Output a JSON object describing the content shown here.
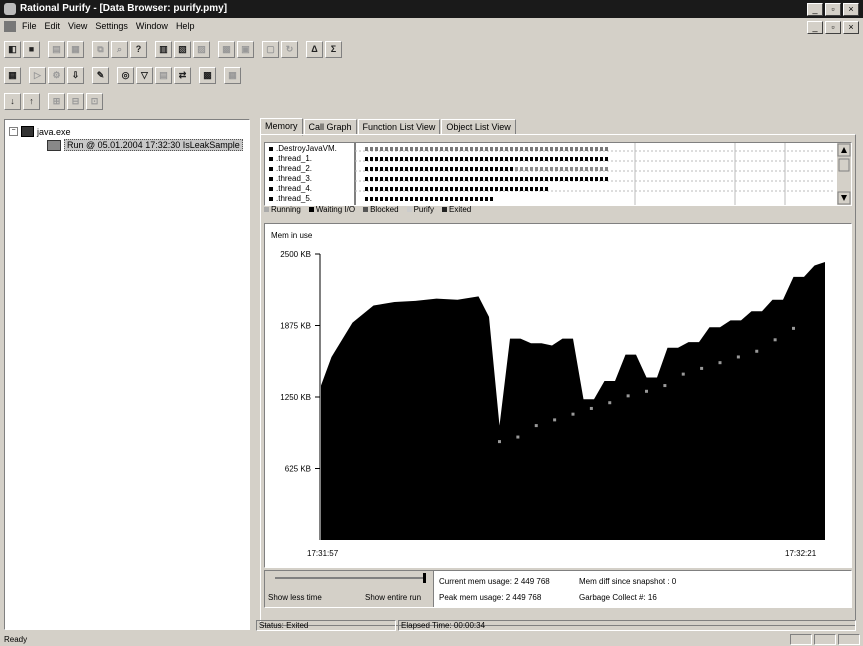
{
  "window": {
    "title": "Rational Purify - [Data Browser: purify.pmy]",
    "min": "_",
    "max": "▫",
    "close": "×"
  },
  "menu": [
    "File",
    "Edit",
    "View",
    "Settings",
    "Window",
    "Help"
  ],
  "tree": {
    "root": "java.exe",
    "child": "Run @ 05.01.2004 17:32:30 IsLeakSample"
  },
  "tabs": [
    "Memory",
    "Call Graph",
    "Function List View",
    "Object List View"
  ],
  "threads": [
    ".DestroyJavaVM.",
    ".thread_1.",
    ".thread_2.",
    ".thread_3.",
    ".thread_4.",
    ".thread_5."
  ],
  "legend": [
    "Running",
    "Waiting I/O",
    "Blocked",
    "Purify",
    "Exited"
  ],
  "chart_data": {
    "type": "area",
    "title": "Mem in use",
    "yticks": [
      "2500 KB",
      "1875 KB",
      "1250 KB",
      "625 KB"
    ],
    "ylim": [
      0,
      2500
    ],
    "xlabels": [
      "17:31:57",
      "17:32:21"
    ],
    "x": [
      0,
      0.5,
      1.5,
      2.5,
      3.5,
      4.5,
      5.5,
      6.5,
      7.5,
      8.0,
      8.5,
      9.0,
      9.5,
      10.0,
      10.5,
      11.0,
      11.5,
      12.0,
      12.5,
      13.0,
      13.5,
      14.0,
      14.5,
      15.0,
      15.5,
      16.0,
      16.5,
      17.0,
      17.5,
      18.0,
      18.5,
      19.0,
      19.5,
      20.0,
      20.5,
      21.0,
      21.5,
      22.0,
      22.5,
      23.0,
      23.5,
      24.0
    ],
    "values": [
      1350,
      1600,
      1900,
      2050,
      2080,
      2090,
      2110,
      2100,
      2130,
      1950,
      1000,
      1760,
      1760,
      1720,
      1720,
      1700,
      1760,
      1760,
      1230,
      1230,
      1390,
      1390,
      1620,
      1620,
      1420,
      1420,
      1680,
      1680,
      1730,
      1730,
      1860,
      1860,
      1920,
      1920,
      2000,
      2000,
      2100,
      2100,
      2300,
      2300,
      2400,
      2430
    ],
    "marker_values": [
      860,
      900,
      1000,
      1050,
      1100,
      1150,
      1200,
      1260,
      1300,
      1350,
      1450,
      1500,
      1550,
      1600,
      1650,
      1750,
      1850
    ]
  },
  "bottom": {
    "show_less": "Show less time",
    "show_entire": "Show entire run",
    "current": "Current mem usage: 2 449 768",
    "peak": "Peak mem usage: 2 449 768",
    "mem_diff": "Mem diff since snapshot : 0",
    "gc": "Garbage Collect #: 16"
  },
  "status": {
    "state": "Status: Exited",
    "elapsed": "Elapsed Time: 00:00:34",
    "ready": "Ready"
  }
}
